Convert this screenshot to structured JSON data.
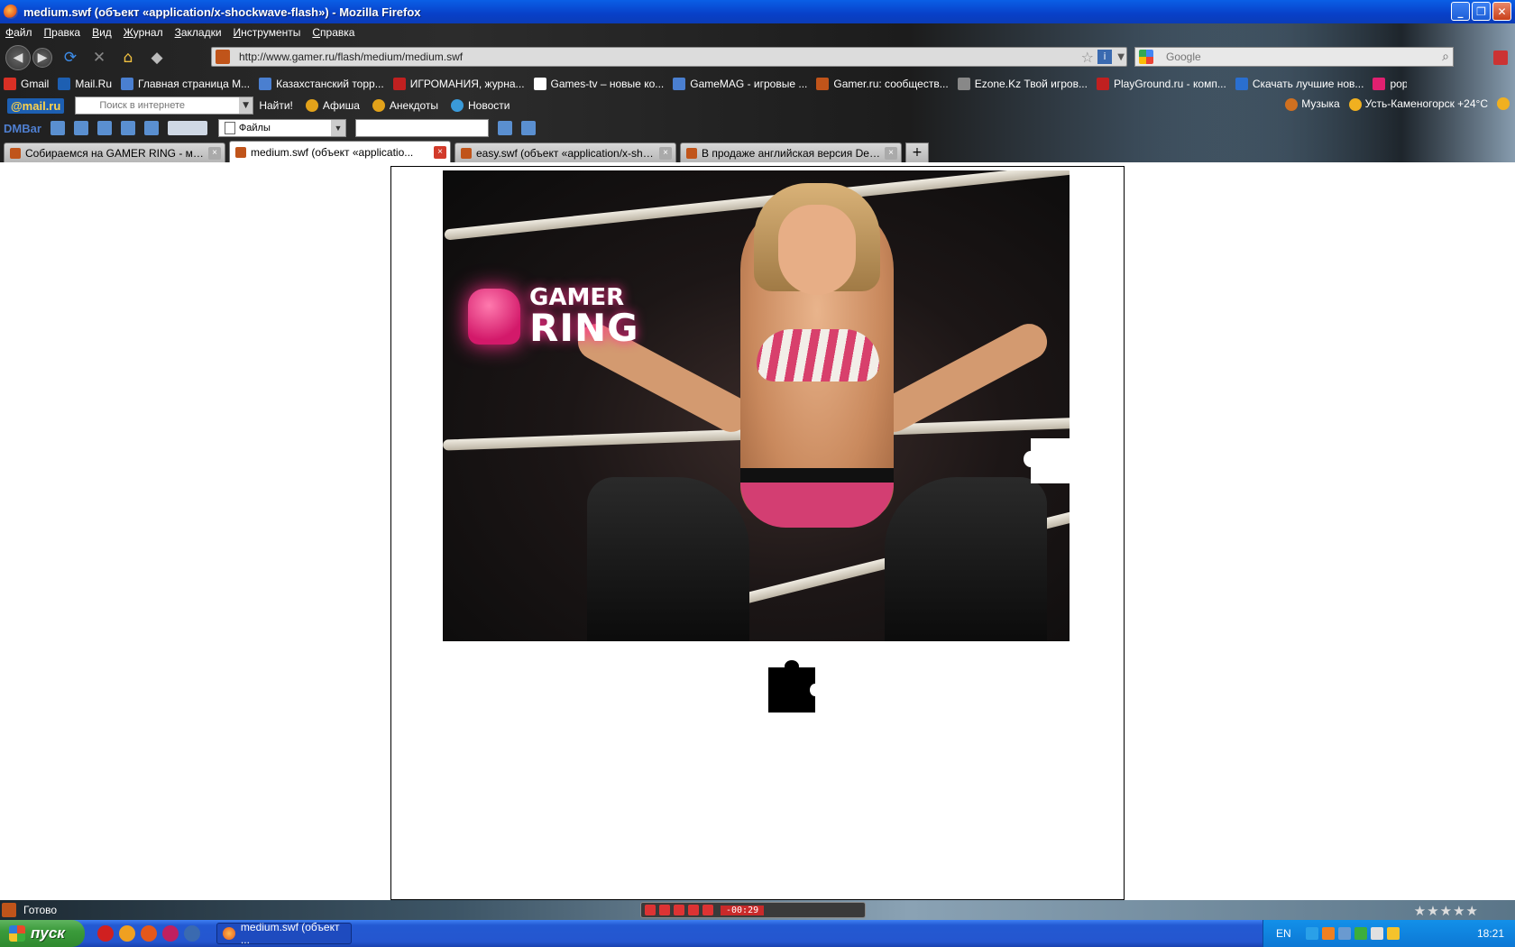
{
  "window": {
    "title": "medium.swf (объект «application/x-shockwave-flash») - Mozilla Firefox",
    "buttons": {
      "minimize": "_",
      "maximize": "❐",
      "close": "✕"
    }
  },
  "menu": [
    "Файл",
    "Правка",
    "Вид",
    "Журнал",
    "Закладки",
    "Инструменты",
    "Справка"
  ],
  "navigation": {
    "url": "http://www.gamer.ru/flash/medium/medium.swf",
    "search_placeholder": "Google"
  },
  "bookmarks": [
    {
      "label": "Gmail",
      "color": "#d93025"
    },
    {
      "label": "Mail.Ru",
      "color": "#1d5fb2"
    },
    {
      "label": "Главная страница M...",
      "color": "#4a7fd0"
    },
    {
      "label": "Казахстанский торр...",
      "color": "#4a7fd0"
    },
    {
      "label": "ИГРОМАНИЯ, журна...",
      "color": "#c02020"
    },
    {
      "label": "Games-tv – новые ко...",
      "color": "#ffffff"
    },
    {
      "label": "GameMAG - игровые ...",
      "color": "#4a7fd0"
    },
    {
      "label": "Gamer.ru: сообществ...",
      "color": "#c0541a"
    },
    {
      "label": "Ezone.Kz Твой игров...",
      "color": "#888888"
    },
    {
      "label": "PlayGround.ru - комп...",
      "color": "#c02020"
    },
    {
      "label": "Скачать лучшие нов...",
      "color": "#2a6fd0"
    },
    {
      "label": "popcornnews - popcor...",
      "color": "#e02070"
    }
  ],
  "mailru": {
    "logo": "@mail.ru",
    "search_placeholder": "Поиск в интернете",
    "find_button": "Найти!",
    "links": [
      "Афиша",
      "Анекдоты",
      "Новости"
    ],
    "music": "Музыка",
    "weather": "Усть-Каменогорск +24°C"
  },
  "dmbar": {
    "logo": "DMBar",
    "files_select": "Файлы"
  },
  "tabs": [
    {
      "label": "Собираемся на GAMER RING - минико...",
      "active": false
    },
    {
      "label": "medium.swf (объект «applicatio...",
      "active": true
    },
    {
      "label": "easy.swf (объект «application/x-shock...",
      "active": false
    },
    {
      "label": "В продаже английская версия Dead ...",
      "active": false
    }
  ],
  "content": {
    "logo_line1": "GAMER",
    "logo_line2": "RING"
  },
  "status": {
    "text": "Готово",
    "player_time": "-00:29",
    "rating": "★★★★★"
  },
  "taskbar": {
    "start": "пуск",
    "task_label": "medium.swf (объект ...",
    "language": "EN",
    "clock": "18:21"
  }
}
